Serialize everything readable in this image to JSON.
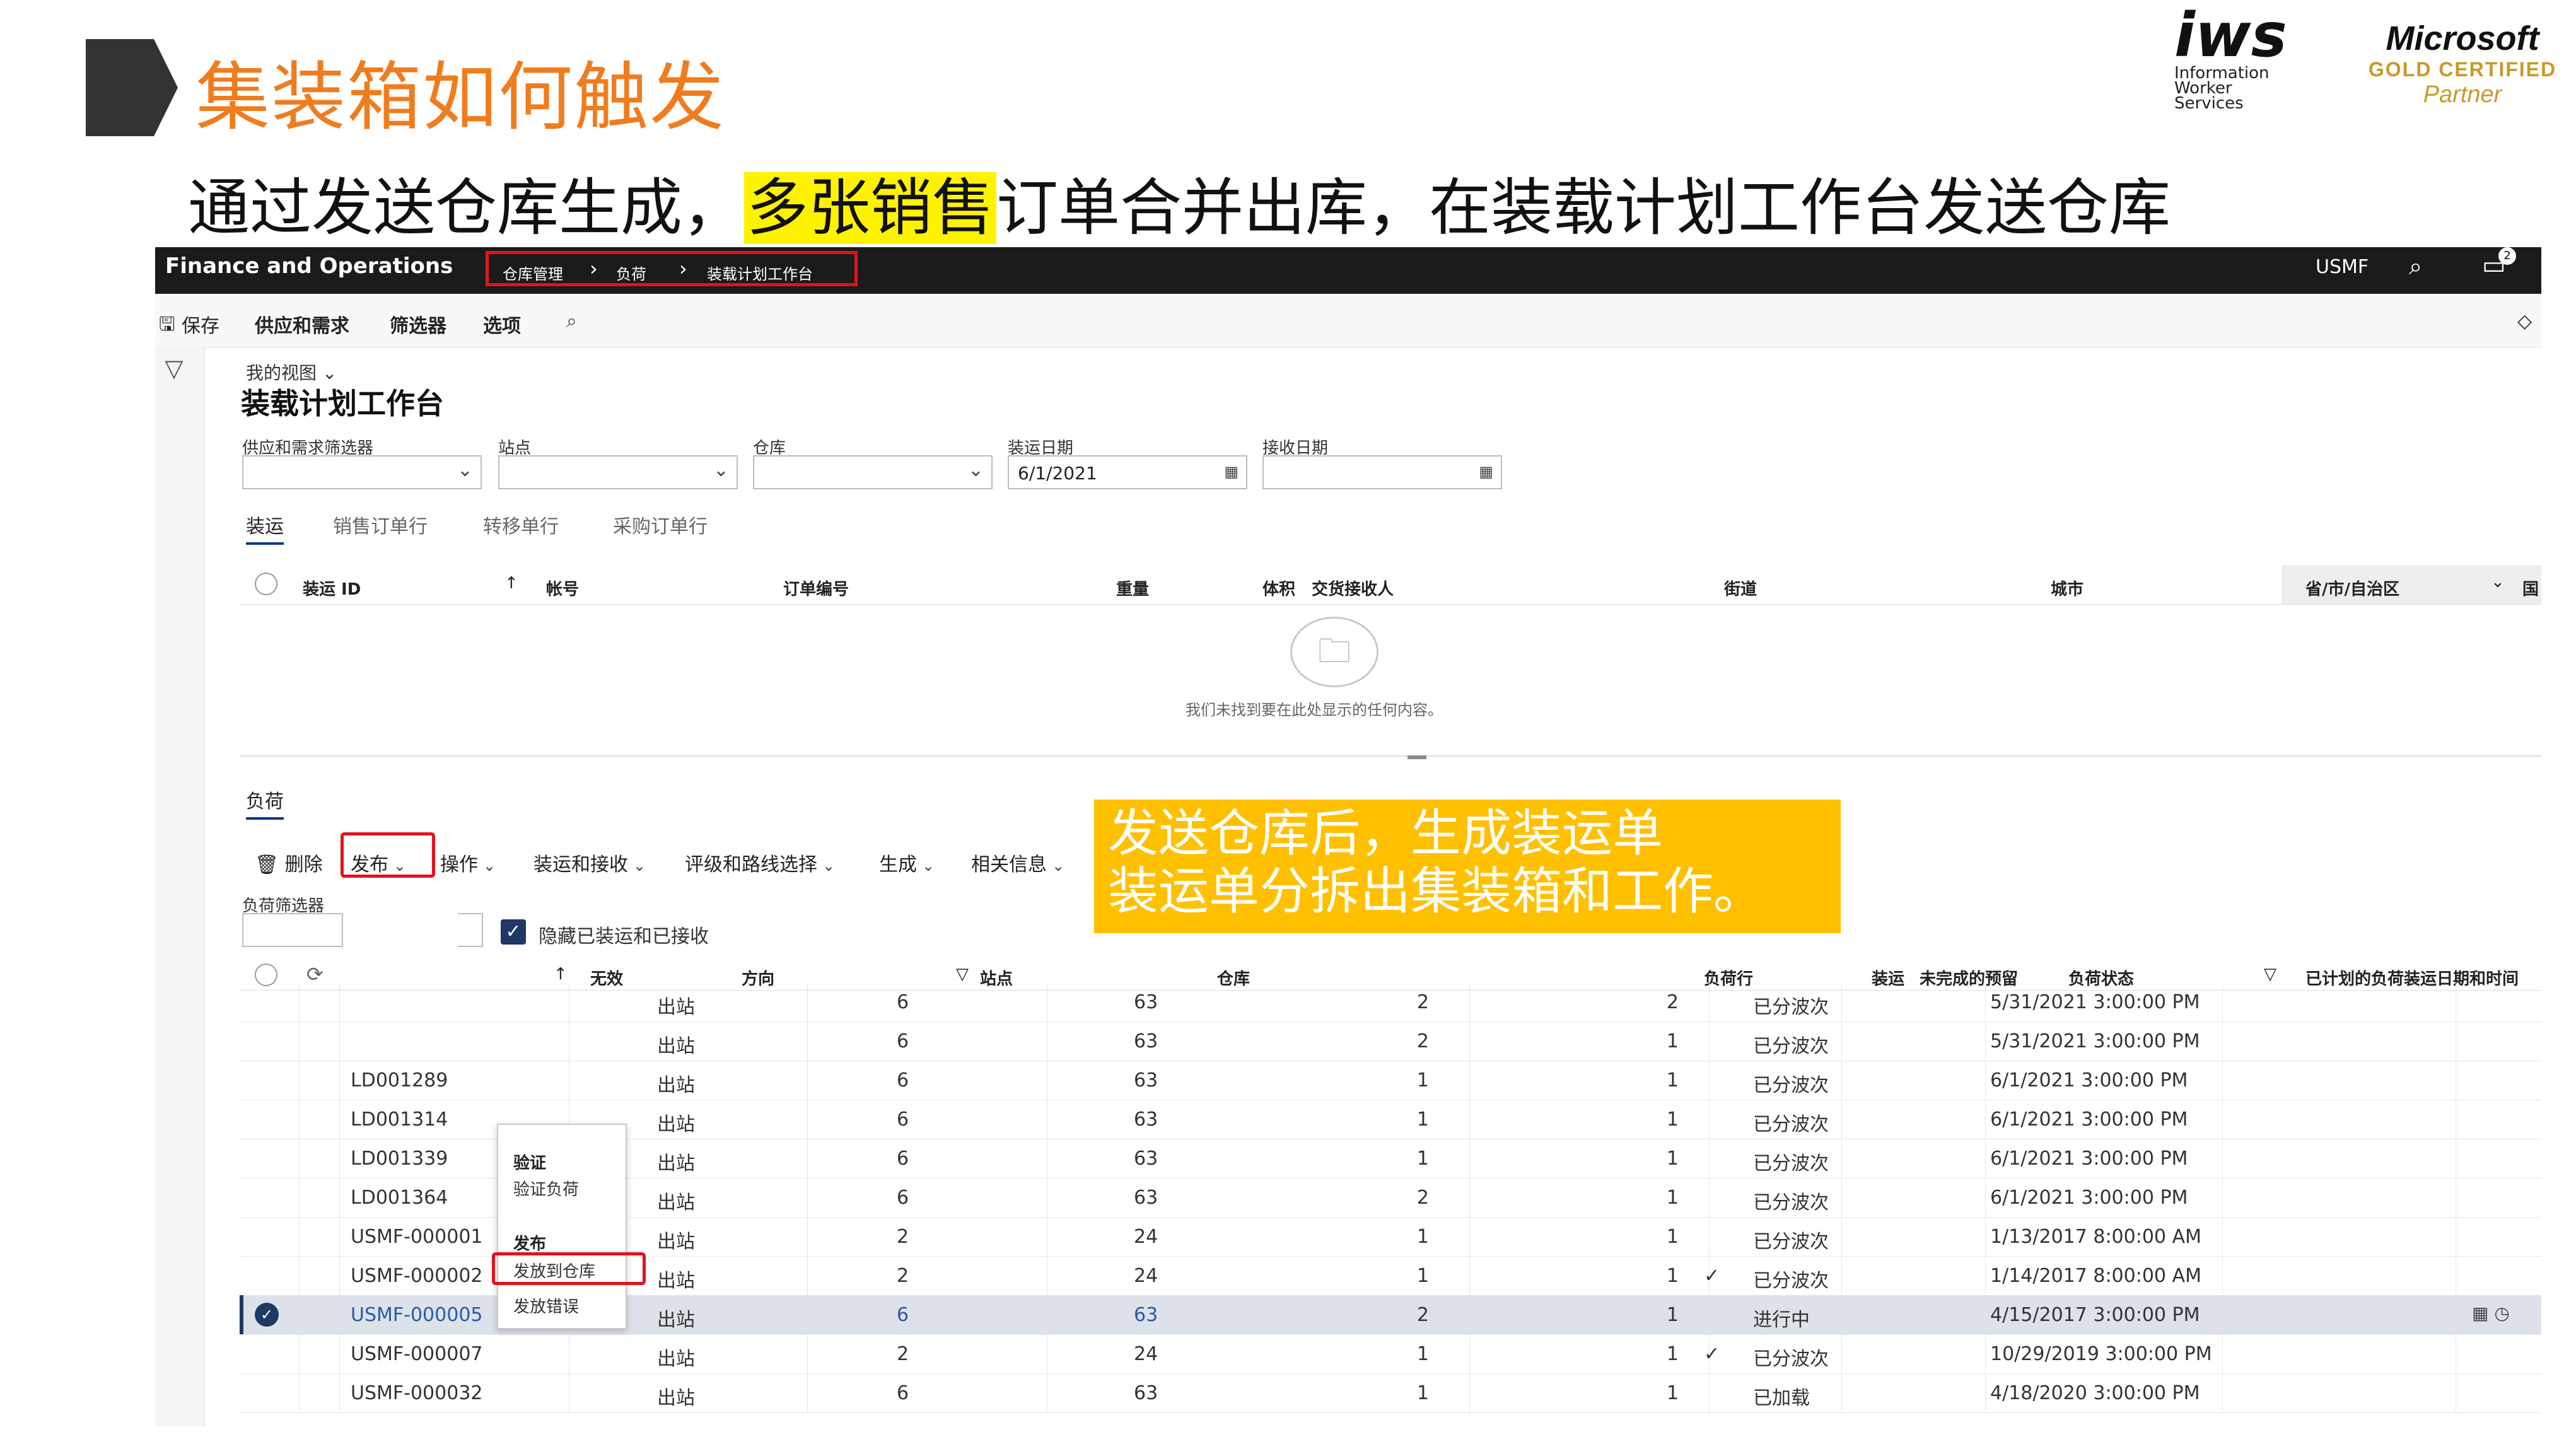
{
  "slide": {
    "title": "集装箱如何触发",
    "subtitle_before": "通过发送仓库生成，",
    "subtitle_highlight": "多张销售",
    "subtitle_after": "订单合并出库，在装载计划工作台发送仓库",
    "logo_iws_big": "iws",
    "logo_iws_lines": [
      "Information",
      "Worker",
      "Services"
    ],
    "logo_ms_big": "Microsoft",
    "logo_ms_gold": "GOLD CERTIFIED",
    "logo_ms_partner": "Partner",
    "callout_lines": [
      "发送仓库后，生成装运单",
      "装运单分拆出集装箱和工作。"
    ],
    "colors": {
      "title": "#f07c1e",
      "highlight": "#fff200",
      "callout": "#ffc000",
      "annotation": "#e3121b"
    }
  },
  "app": {
    "name": "Finance and Operations",
    "breadcrumb": [
      "仓库管理",
      "负荷",
      "装载计划工作台"
    ],
    "company": "USMF",
    "notification_count": "2",
    "actionbar": {
      "save": "保存",
      "supply_demand": "供应和需求",
      "filters": "筛选器",
      "options": "选项"
    }
  },
  "page": {
    "view_label": "我的视图",
    "title": "装载计划工作台",
    "filters": {
      "supply_demand_label": "供应和需求筛选器",
      "site_label": "站点",
      "warehouse_label": "仓库",
      "ship_date_label": "装运日期",
      "ship_date_value": "6/1/2021",
      "receipt_date_label": "接收日期"
    },
    "tabs": [
      "装运",
      "销售订单行",
      "转移单行",
      "采购订单行"
    ],
    "upper_grid_headers": [
      "装运 ID",
      "帐号",
      "订单编号",
      "重量",
      "体积",
      "交货接收人",
      "街道",
      "城市",
      "省/市/自治区",
      "国"
    ],
    "empty_message": "我们未找到要在此处显示的任何内容。"
  },
  "loads": {
    "section_title": "负荷",
    "commands": {
      "delete": "删除",
      "release": "发布",
      "operations": "操作",
      "ship_receive": "装运和接收",
      "rating_routing": "评级和路线选择",
      "generate": "生成",
      "related": "相关信息"
    },
    "filter_label": "负荷筛选器",
    "hide_checkbox_label": "隐藏已装运和已接收",
    "menu": {
      "section_validate": "验证",
      "validate_load": "验证负荷",
      "section_release": "发布",
      "release_to_warehouse": "发放到仓库",
      "release_errors": "发放错误"
    },
    "columns": [
      "无效",
      "方向",
      "站点",
      "仓库",
      "负荷行",
      "装运",
      "未完成的预留",
      "负荷状态",
      "已计划的负荷装运日期和时间"
    ],
    "rows": [
      {
        "id": "",
        "dir": "出站",
        "site": "6",
        "wh": "63",
        "lines": "2",
        "ship": "2",
        "open": "",
        "status": "已分波次",
        "dt": "5/31/2021 3:00:00 PM"
      },
      {
        "id": "",
        "dir": "出站",
        "site": "6",
        "wh": "63",
        "lines": "2",
        "ship": "1",
        "open": "",
        "status": "已分波次",
        "dt": "5/31/2021 3:00:00 PM"
      },
      {
        "id": "LD001289",
        "dir": "出站",
        "site": "6",
        "wh": "63",
        "lines": "1",
        "ship": "1",
        "open": "",
        "status": "已分波次",
        "dt": "6/1/2021 3:00:00 PM"
      },
      {
        "id": "LD001314",
        "dir": "出站",
        "site": "6",
        "wh": "63",
        "lines": "1",
        "ship": "1",
        "open": "",
        "status": "已分波次",
        "dt": "6/1/2021 3:00:00 PM"
      },
      {
        "id": "LD001339",
        "dir": "出站",
        "site": "6",
        "wh": "63",
        "lines": "1",
        "ship": "1",
        "open": "",
        "status": "已分波次",
        "dt": "6/1/2021 3:00:00 PM"
      },
      {
        "id": "LD001364",
        "dir": "出站",
        "site": "6",
        "wh": "63",
        "lines": "2",
        "ship": "1",
        "open": "",
        "status": "已分波次",
        "dt": "6/1/2021 3:00:00 PM"
      },
      {
        "id": "USMF-000001",
        "dir": "出站",
        "site": "2",
        "wh": "24",
        "lines": "1",
        "ship": "1",
        "open": "",
        "status": "已分波次",
        "dt": "1/13/2017 8:00:00 AM"
      },
      {
        "id": "USMF-000002",
        "dir": "出站",
        "site": "2",
        "wh": "24",
        "lines": "1",
        "ship": "1",
        "open": "✓",
        "status": "已分波次",
        "dt": "1/14/2017 8:00:00 AM"
      },
      {
        "id": "USMF-000005",
        "dir": "出站",
        "site": "6",
        "wh": "63",
        "lines": "2",
        "ship": "1",
        "open": "",
        "status": "进行中",
        "dt": "4/15/2017 3:00:00 PM"
      },
      {
        "id": "USMF-000007",
        "dir": "出站",
        "site": "2",
        "wh": "24",
        "lines": "1",
        "ship": "1",
        "open": "✓",
        "status": "已分波次",
        "dt": "10/29/2019 3:00:00 PM"
      },
      {
        "id": "USMF-000032",
        "dir": "出站",
        "site": "6",
        "wh": "63",
        "lines": "1",
        "ship": "1",
        "open": "",
        "status": "已加载",
        "dt": "4/18/2020 3:00:00 PM"
      }
    ]
  }
}
